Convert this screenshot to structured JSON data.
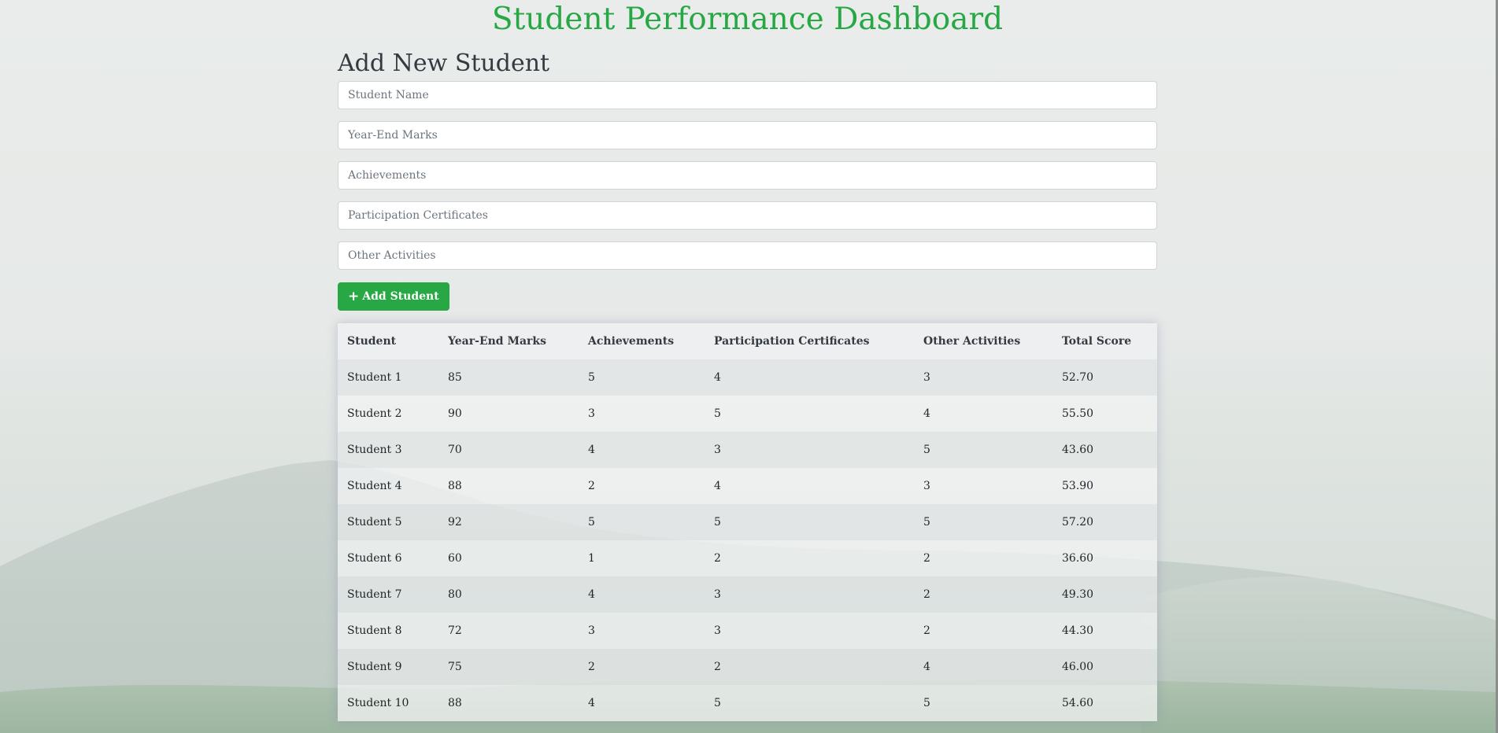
{
  "page": {
    "title": "Student Performance Dashboard",
    "section_title": "Add New Student"
  },
  "form": {
    "name_placeholder": "Student Name",
    "marks_placeholder": "Year-End Marks",
    "achievements_placeholder": "Achievements",
    "certificates_placeholder": "Participation Certificates",
    "activities_placeholder": "Other Activities",
    "add_button_label": "Add Student",
    "add_button_icon": "plus-icon"
  },
  "table": {
    "headers": [
      "Student",
      "Year-End Marks",
      "Achievements",
      "Participation Certificates",
      "Other Activities",
      "Total Score"
    ],
    "rows": [
      [
        "Student 1",
        "85",
        "5",
        "4",
        "3",
        "52.70"
      ],
      [
        "Student 2",
        "90",
        "3",
        "5",
        "4",
        "55.50"
      ],
      [
        "Student 3",
        "70",
        "4",
        "3",
        "5",
        "43.60"
      ],
      [
        "Student 4",
        "88",
        "2",
        "4",
        "3",
        "53.90"
      ],
      [
        "Student 5",
        "92",
        "5",
        "5",
        "5",
        "57.20"
      ],
      [
        "Student 6",
        "60",
        "1",
        "2",
        "2",
        "36.60"
      ],
      [
        "Student 7",
        "80",
        "4",
        "3",
        "2",
        "49.30"
      ],
      [
        "Student 8",
        "72",
        "3",
        "3",
        "2",
        "44.30"
      ],
      [
        "Student 9",
        "75",
        "2",
        "2",
        "4",
        "46.00"
      ],
      [
        "Student 10",
        "88",
        "4",
        "5",
        "5",
        "54.60"
      ]
    ]
  },
  "colors": {
    "accent": "#28a745",
    "heading": "#343a40",
    "border": "#ced4da"
  }
}
